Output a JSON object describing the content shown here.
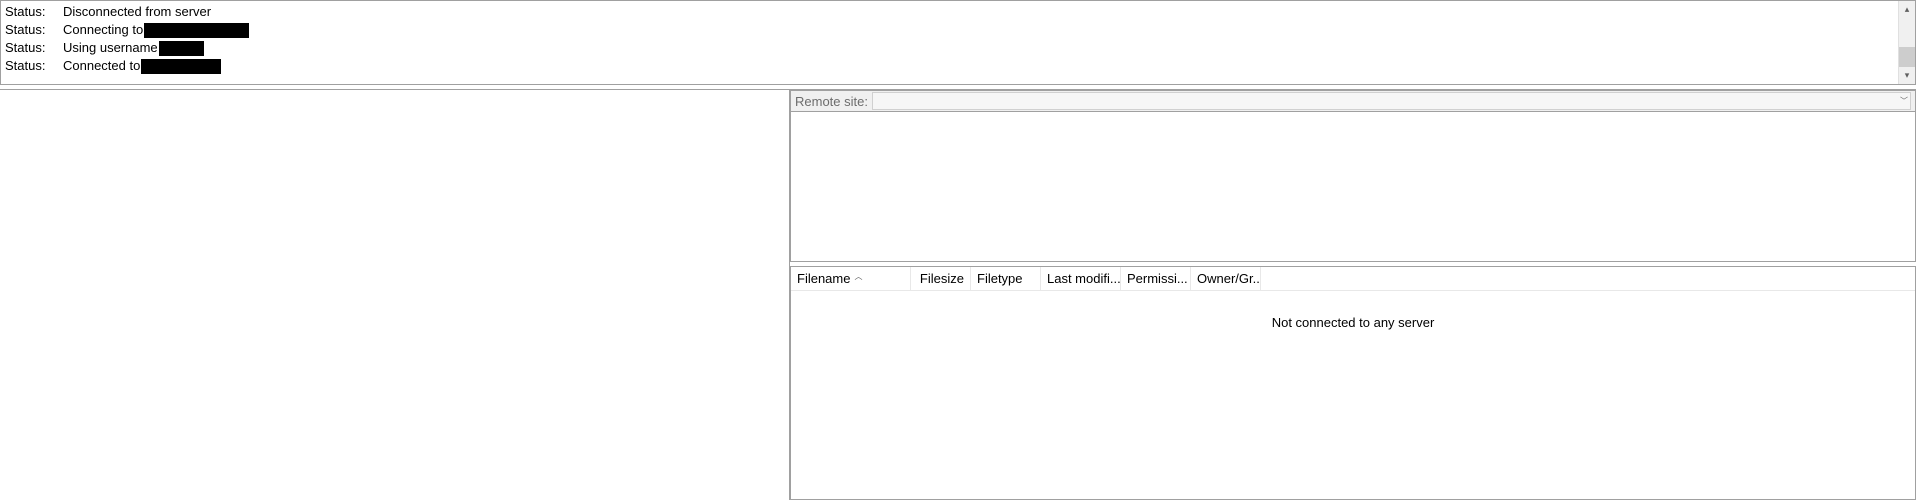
{
  "log": {
    "label": "Status:",
    "lines": [
      {
        "msg": "Disconnected from server",
        "redact": null
      },
      {
        "msg": "Connecting to",
        "redact": "w1"
      },
      {
        "msg": "Using username",
        "redact": "w2"
      },
      {
        "msg": "Connected to",
        "redact": "w3"
      }
    ]
  },
  "remote": {
    "site_label": "Remote site:",
    "site_value": "",
    "columns": {
      "filename": "Filename",
      "filesize": "Filesize",
      "filetype": "Filetype",
      "modified": "Last modifi...",
      "permissions": "Permissi...",
      "owner": "Owner/Gr..."
    },
    "empty_message": "Not connected to any server"
  }
}
